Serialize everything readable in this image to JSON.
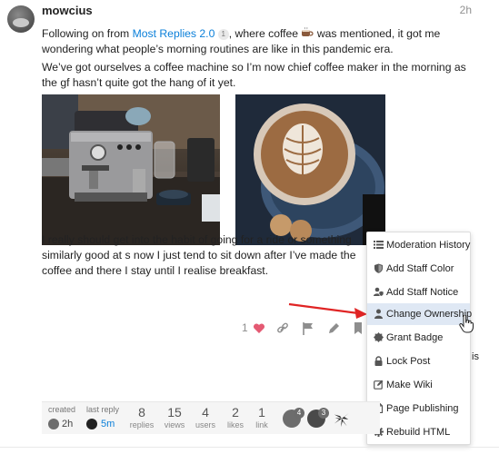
{
  "post": {
    "username": "mowcius",
    "age": "2h",
    "p1_before": "Following on from ",
    "p1_link": "Most Replies 2.0",
    "p1_link_badge": "1",
    "p1_mid": ", where coffee ",
    "p1_after": " was mentioned, it got me wondering what people’s morning routines are like in this pandemic era.",
    "p2": "We’ve got ourselves a coffee machine so I’m now chief coffee maker in the morning as the gf hasn’t quite got the hang of it yet.",
    "p3": "I really should get into the habit of going for a ride or something similarly good at s now I just tend to sit down after I’ve made the coffee and there I stay until I realise breakfast.",
    "photo1_brand": "Breville",
    "emoji": "coffee-icon"
  },
  "actions": {
    "like_count": "1",
    "icons": [
      "heart-icon",
      "link-icon",
      "flag-icon",
      "pencil-icon",
      "bookmark-icon"
    ]
  },
  "menu": {
    "items": [
      {
        "label": "Moderation History",
        "icon": "list-icon"
      },
      {
        "label": "Add Staff Color",
        "icon": "shield-icon"
      },
      {
        "label": "Add Staff Notice",
        "icon": "user-shield-icon"
      },
      {
        "label": "Change Ownership",
        "icon": "user-icon",
        "highlighted": true
      },
      {
        "label": "Grant Badge",
        "icon": "certificate-icon"
      },
      {
        "label": "Lock Post",
        "icon": "lock-icon"
      },
      {
        "label": "Make Wiki",
        "icon": "pencil-square-icon"
      },
      {
        "label": "Page Publishing",
        "icon": "file-icon"
      },
      {
        "label": "Rebuild HTML",
        "icon": "cog-icon"
      }
    ],
    "cut_text": "is"
  },
  "summary": {
    "created_label": "created",
    "created_value": "2h",
    "last_reply_label": "last reply",
    "last_reply_value": "5m",
    "replies": {
      "num": "8",
      "label": "replies"
    },
    "views": {
      "num": "15",
      "label": "views"
    },
    "users": {
      "num": "4",
      "label": "users"
    },
    "likes": {
      "num": "2",
      "label": "likes"
    },
    "links": {
      "num": "1",
      "label": "link"
    },
    "participants": [
      {
        "count": "4",
        "color": "#6d6d6d"
      },
      {
        "count": "3",
        "color": "#4a4a4a"
      },
      {
        "count": "",
        "color": "#222222"
      }
    ]
  },
  "colors": {
    "link": "#0a7fd9",
    "heart": "#e45a73",
    "arrow": "#e02424",
    "menu_highlight": "#dfe8f4"
  }
}
